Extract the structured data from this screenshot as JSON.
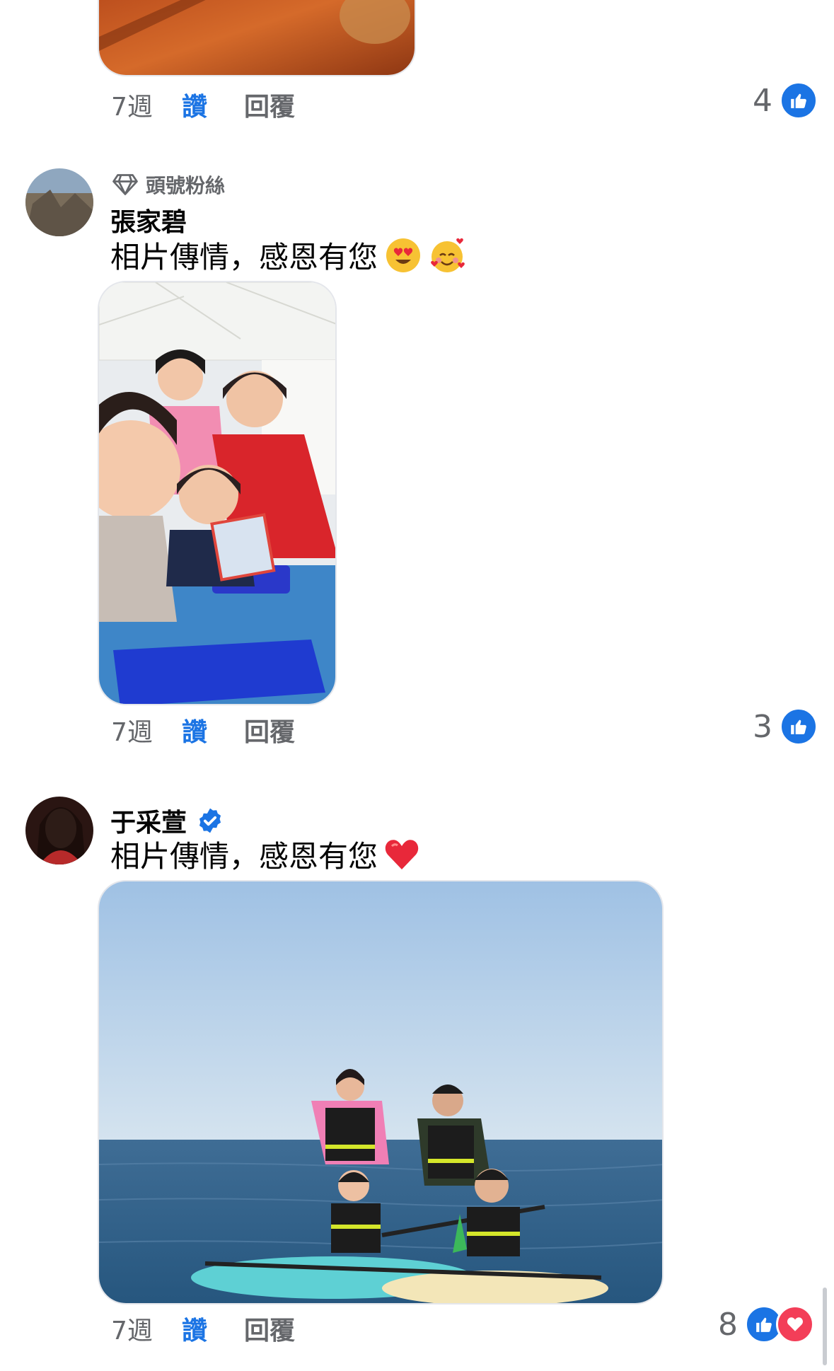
{
  "comments": [
    {
      "time": "7週",
      "like_label": "讚",
      "reply_label": "回覆",
      "reaction_count": "4"
    },
    {
      "badge": "頭號粉絲",
      "author": "張家碧",
      "text": "相片傳情，感恩有您",
      "emojis": [
        "heart-eyes-icon",
        "smiling-face-with-hearts-icon"
      ],
      "time": "7週",
      "like_label": "讚",
      "reply_label": "回覆",
      "reaction_count": "3"
    },
    {
      "author": "于采萱",
      "verified": true,
      "text": "相片傳情，感恩有您",
      "emojis": [
        "red-heart-icon"
      ],
      "time": "7週",
      "like_label": "讚",
      "reply_label": "回覆",
      "reaction_count": "8"
    }
  ],
  "colors": {
    "accent": "#1b74e4",
    "love": "#f33e58",
    "muted": "#65676b"
  }
}
